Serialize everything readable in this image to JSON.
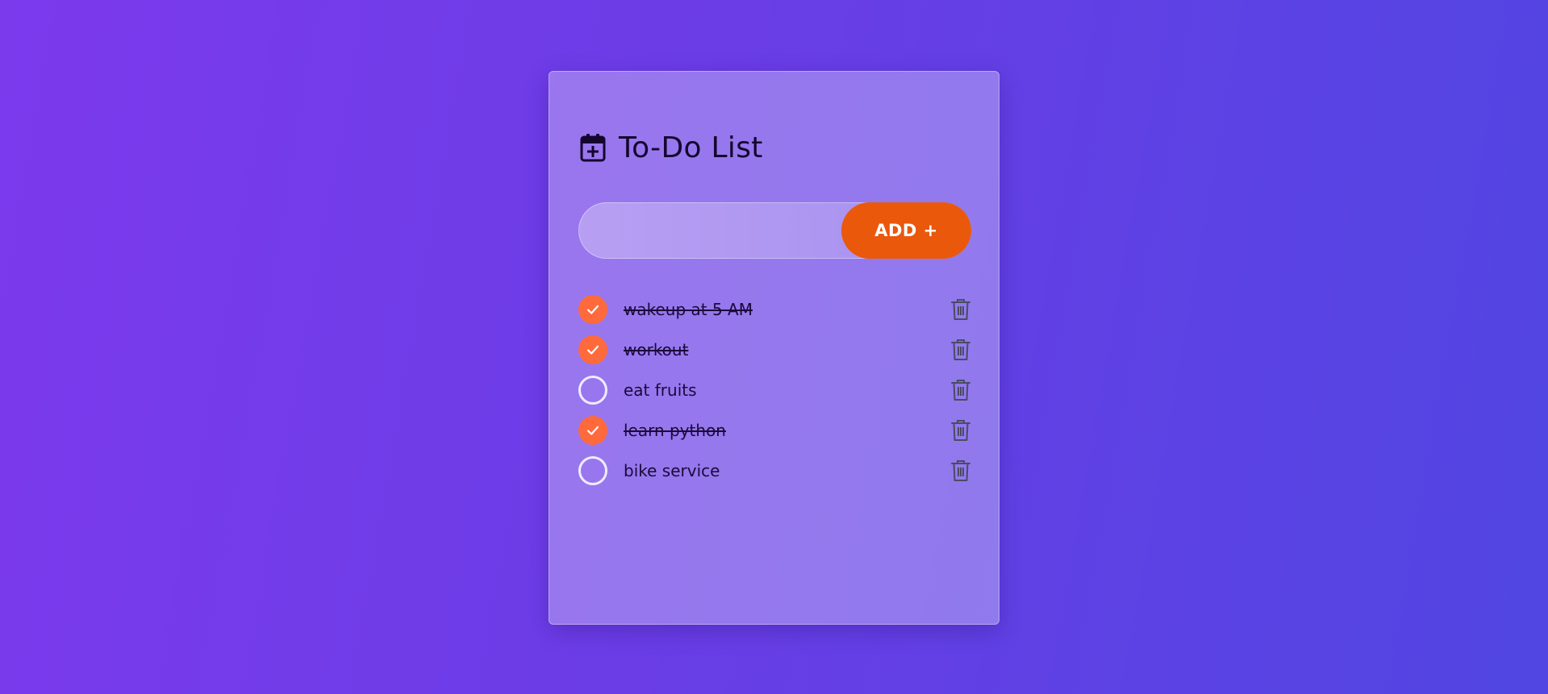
{
  "app": {
    "title": "To-Do List",
    "title_icon": "calendar-plus-icon",
    "colors": {
      "background_start": "#7c3aed",
      "background_end": "#5146e2",
      "accent": "#ea580c",
      "check_done": "#ff6a3d"
    }
  },
  "input": {
    "value": "",
    "placeholder": ""
  },
  "add_button": {
    "label": "ADD +"
  },
  "tasks": [
    {
      "text": "wakeup at 5 AM",
      "done": true
    },
    {
      "text": "workout",
      "done": true
    },
    {
      "text": "eat fruits",
      "done": false
    },
    {
      "text": "learn python",
      "done": true
    },
    {
      "text": "bike service",
      "done": false
    }
  ],
  "icons": {
    "checked": "checkmark-icon",
    "delete": "trash-icon"
  }
}
